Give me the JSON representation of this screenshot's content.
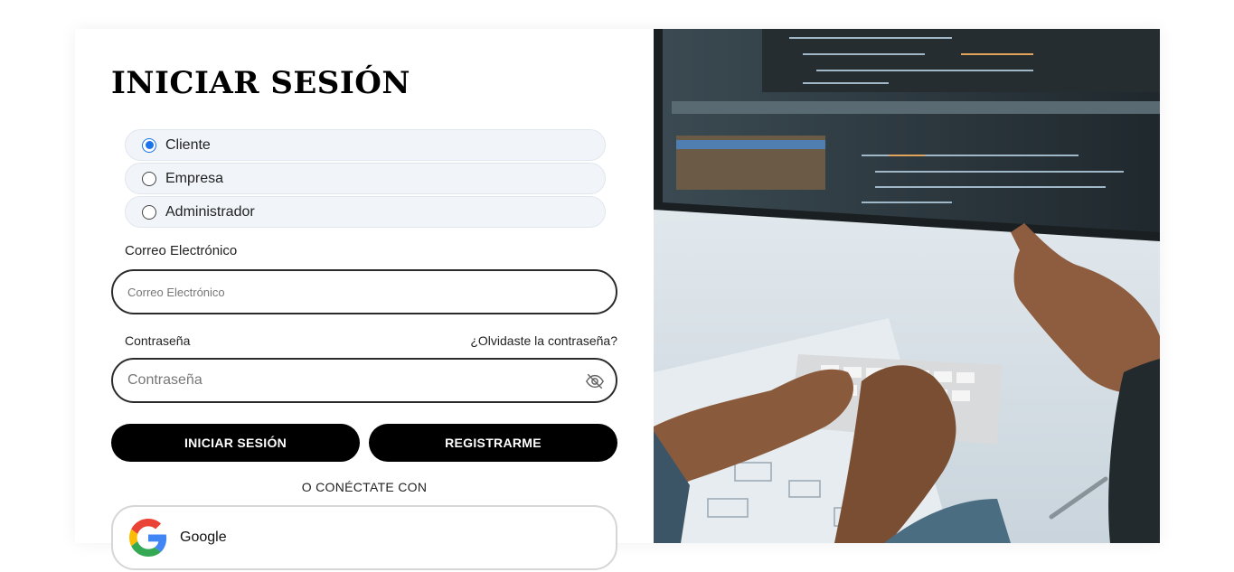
{
  "login": {
    "title": "INICIAR SESIÓN",
    "roles": [
      {
        "label": "Cliente",
        "checked": true
      },
      {
        "label": "Empresa",
        "checked": false
      },
      {
        "label": "Administrador",
        "checked": false
      }
    ],
    "email": {
      "label": "Correo Electrónico",
      "placeholder": "Correo Electrónico",
      "value": ""
    },
    "password": {
      "label": "Contraseña",
      "placeholder": "Contraseña",
      "value": "",
      "forgot_link": "¿Olvidaste la contraseña?",
      "toggle_icon": "eye-off-icon"
    },
    "buttons": {
      "login": "INICIAR SESIÓN",
      "register": "REGISTRARME"
    },
    "connect_with": "O CONÉCTATE CON",
    "google": {
      "label": "Google",
      "icon": "google-logo-icon"
    }
  },
  "hero_image": {
    "icon": "developer-coding-photo"
  },
  "colors": {
    "button_bg": "#000000",
    "radio_accent": "#1a73e8",
    "role_bg": "#f1f5fa"
  }
}
